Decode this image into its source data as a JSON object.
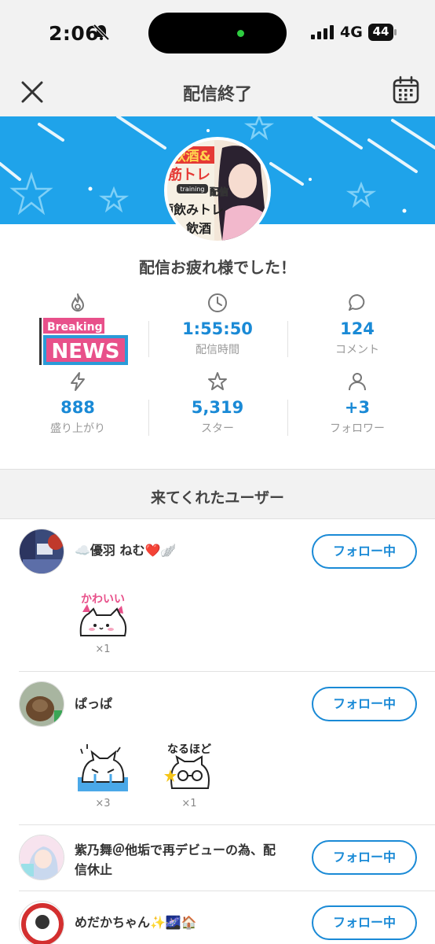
{
  "status_bar": {
    "time": "2:06",
    "network": "4G",
    "battery": "44"
  },
  "header": {
    "title": "配信終了"
  },
  "banner": {
    "avatar_text": [
      "飲酒&",
      "筋トレ",
      "training",
      "配信",
      "酒飲みトレ",
      "飲酒"
    ]
  },
  "greeting": "配信お疲れ様でした！",
  "news_badge": {
    "top": "Breaking",
    "bottom": "NEWS"
  },
  "stats": [
    {
      "icon": "flame-icon",
      "value": "",
      "label": ""
    },
    {
      "icon": "clock-icon",
      "value": "1:55:50",
      "label": "配信時間"
    },
    {
      "icon": "comment-icon",
      "value": "124",
      "label": "コメント"
    },
    {
      "icon": "lightning-icon",
      "value": "888",
      "label": "盛り上がり"
    },
    {
      "icon": "star-icon",
      "value": "5,319",
      "label": "スター"
    },
    {
      "icon": "person-icon",
      "value": "+3",
      "label": "フォロワー"
    }
  ],
  "section_title": "来てくれたユーザー",
  "users": [
    {
      "name": "☁️優羽 ねむ❤️🪽",
      "button": "フォロー中",
      "gifts": [
        {
          "sticker": "かわいい",
          "count": "×1"
        }
      ]
    },
    {
      "name": "ぱっぱ",
      "button": "フォロー中",
      "gifts": [
        {
          "sticker": "crying-cat",
          "count": "×3"
        },
        {
          "sticker": "なるほど",
          "count": "×1"
        }
      ]
    },
    {
      "name": "紫乃舞＠他垢で再デビューの為、配信休止",
      "name_lines": [
        "紫乃舞＠他垢で再デビューの為、配",
        "信休止"
      ],
      "button": "フォロー中",
      "gifts": []
    },
    {
      "name": "めだかちゃん✨🌌🏠",
      "button": "フォロー中",
      "gifts": []
    }
  ],
  "colors": {
    "accent": "#1a8ad6",
    "banner": "#1fa3ea",
    "background": "#f2f2f2"
  }
}
